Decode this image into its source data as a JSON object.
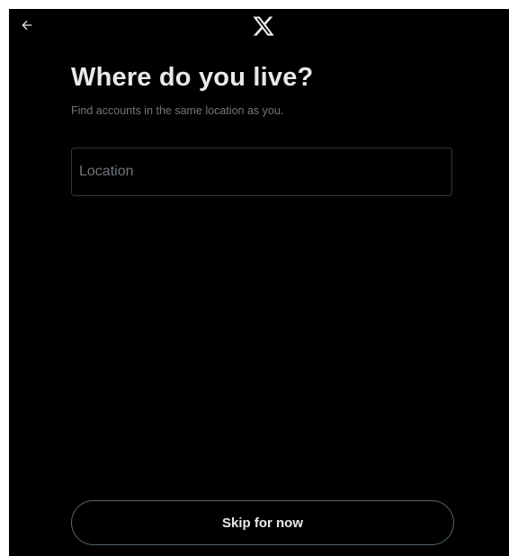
{
  "header": {
    "back_icon": "arrow-left-icon",
    "logo_icon": "x-logo-icon"
  },
  "main": {
    "title": "Where do you live?",
    "subtitle": "Find accounts in the same location as you.",
    "location_field": {
      "value": "",
      "placeholder": "Location"
    }
  },
  "footer": {
    "skip_label": "Skip for now"
  },
  "colors": {
    "background": "#000000",
    "text_primary": "#e7e9ea",
    "text_secondary": "#71767b",
    "border": "#333639"
  }
}
